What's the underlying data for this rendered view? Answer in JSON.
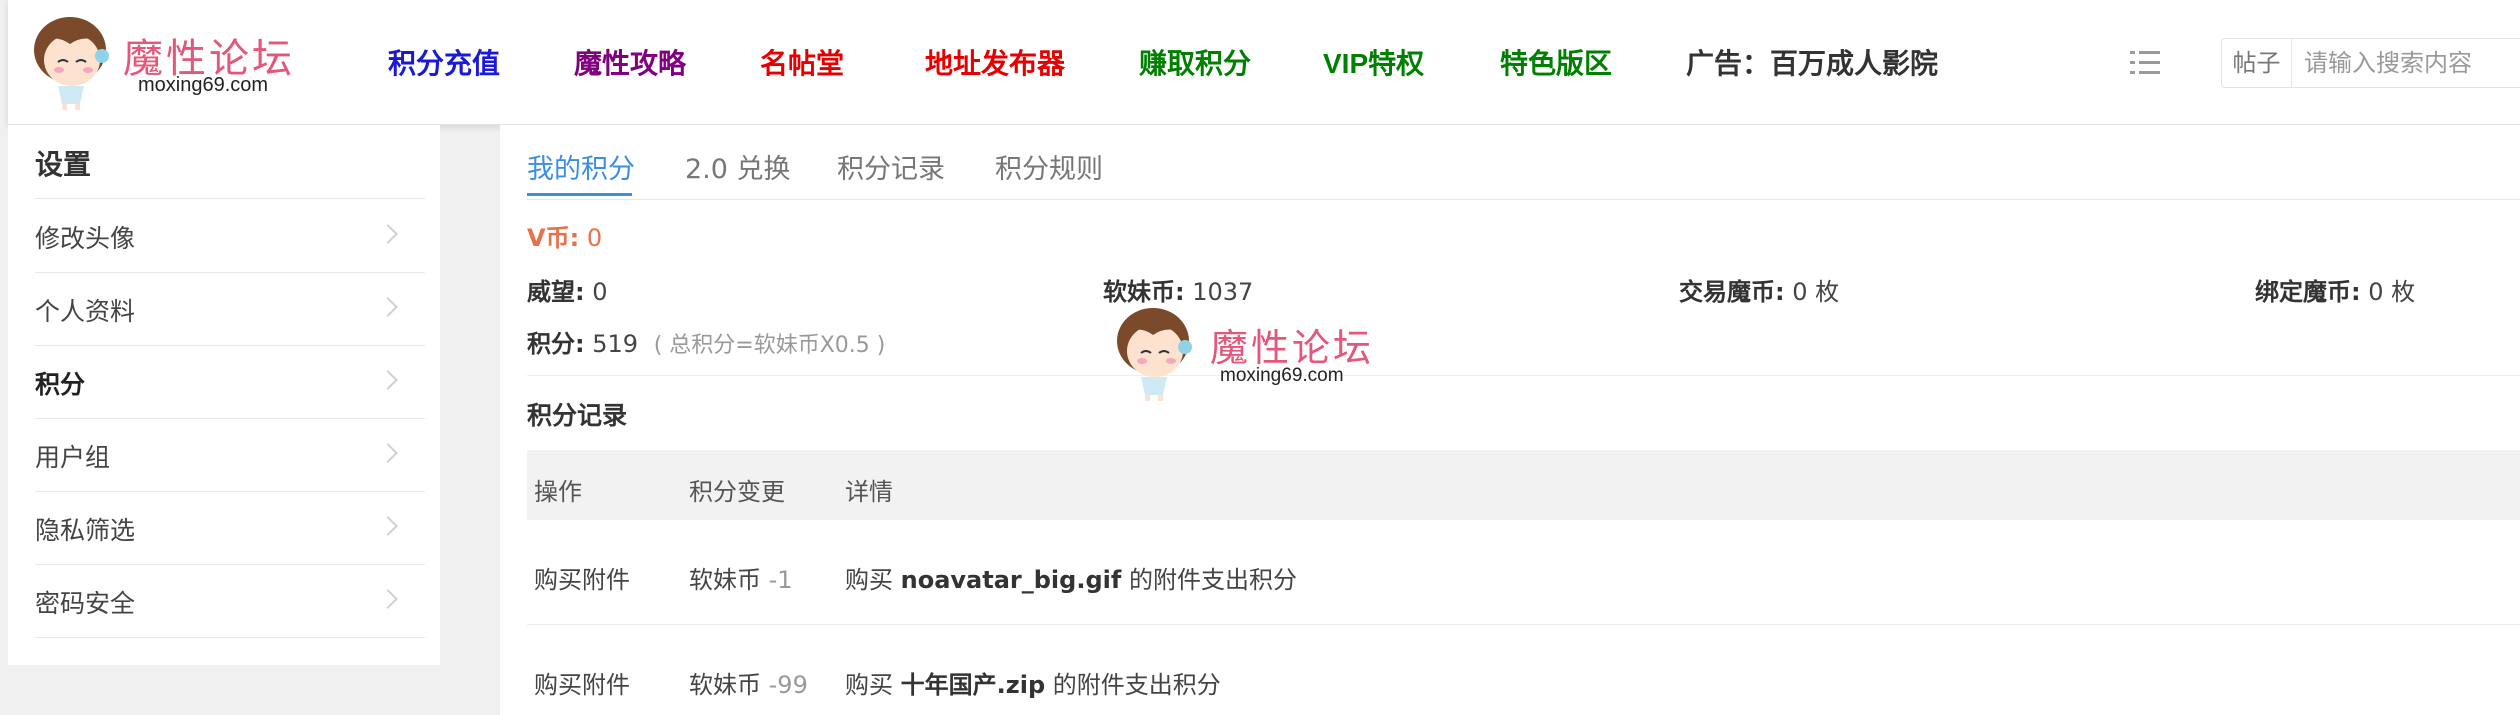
{
  "header": {
    "logo_text": "魔性论坛",
    "logo_domain": "moxing69.com",
    "nav": [
      {
        "label": "积分充值",
        "color": "#1a1ad6"
      },
      {
        "label": "魔性攻略",
        "color": "#800080"
      },
      {
        "label": "名帖堂",
        "color": "#e60000"
      },
      {
        "label": "地址发布器",
        "color": "#e60000"
      },
      {
        "label": "赚取积分",
        "color": "#008000"
      },
      {
        "label": "VIP特权",
        "color": "#008000"
      },
      {
        "label": "特色版区",
        "color": "#008000"
      },
      {
        "label": "广告：百万成人影院",
        "color": "#333333"
      }
    ],
    "menu_icon": "list-icon",
    "search": {
      "type_label": "帖子",
      "placeholder": "请输入搜索内容",
      "value": ""
    }
  },
  "sidebar": {
    "title": "设置",
    "items": [
      {
        "label": "修改头像",
        "active": false
      },
      {
        "label": "个人资料",
        "active": false
      },
      {
        "label": "积分",
        "active": true
      },
      {
        "label": "用户组",
        "active": false
      },
      {
        "label": "隐私筛选",
        "active": false
      },
      {
        "label": "密码安全",
        "active": false
      }
    ]
  },
  "main": {
    "tabs": [
      "我的积分",
      "2.0 兑换",
      "积分记录",
      "积分规则"
    ],
    "active_tab": "我的积分",
    "vcoin": {
      "label": "V币:",
      "value": "0"
    },
    "stats": [
      {
        "label": "威望:",
        "value": "0"
      },
      {
        "label": "软妹币:",
        "value": "1037"
      },
      {
        "label": "交易魔币:",
        "value": "0 枚"
      },
      {
        "label": "绑定魔币:",
        "value": "0 枚"
      }
    ],
    "points": {
      "label": "积分:",
      "value": "519",
      "formula": "( 总积分=软妹币X0.5 )"
    },
    "records_title": "积分记录",
    "table": {
      "headers": [
        "操作",
        "积分变更",
        "详情"
      ],
      "rows": [
        {
          "action": "购买附件",
          "currency": "软妹币",
          "change": "-1",
          "detail_prefix": "购买",
          "file": "noavatar_big.gif",
          "detail_suffix": "的附件支出积分"
        },
        {
          "action": "购买附件",
          "currency": "软妹币",
          "change": "-99",
          "detail_prefix": "购买",
          "file": "十年国产.zip",
          "detail_suffix": "的附件支出积分"
        }
      ]
    }
  },
  "watermark": {
    "text": "魔性论坛",
    "domain": "moxing69.com"
  },
  "colors": {
    "accent": "#3a8ee6",
    "vcoin": "#e8704a",
    "logo": "#e4577a"
  }
}
